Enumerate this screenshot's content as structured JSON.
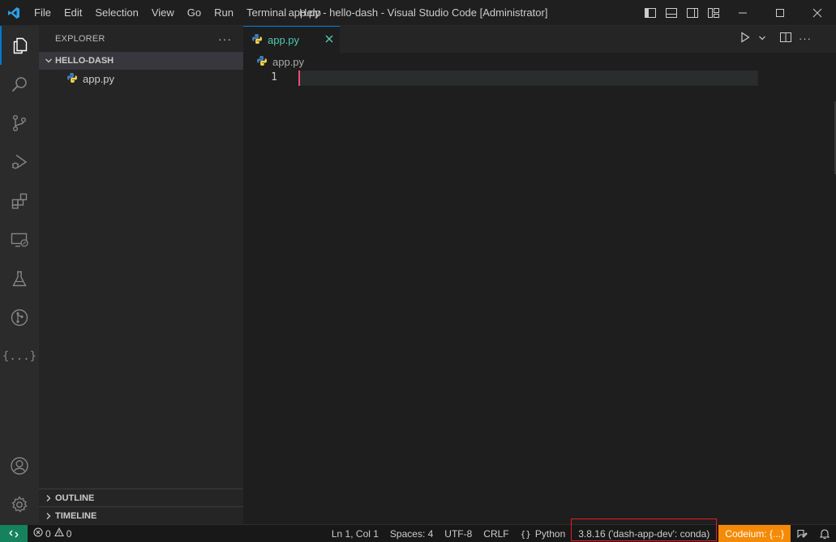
{
  "window": {
    "title": "app.py - hello-dash - Visual Studio Code [Administrator]",
    "menu": [
      "File",
      "Edit",
      "Selection",
      "View",
      "Go",
      "Run",
      "Terminal",
      "Help"
    ]
  },
  "activity_bar": {
    "items": [
      "explorer",
      "search",
      "source-control",
      "run-debug",
      "extensions",
      "remote-explorer",
      "testing",
      "git-graph",
      "json-tools"
    ],
    "bottom": [
      "accounts",
      "manage"
    ],
    "json_glyph": "{...}"
  },
  "sidebar": {
    "title": "EXPLORER",
    "more": "···",
    "folder": "HELLO-DASH",
    "files": [
      {
        "name": "app.py",
        "icon": "python-icon"
      }
    ],
    "outline": "OUTLINE",
    "timeline": "TIMELINE"
  },
  "editor": {
    "tab_label": "app.py",
    "breadcrumb": "app.py",
    "line_numbers": [
      "1"
    ]
  },
  "statusbar": {
    "errors": "0",
    "warnings": "0",
    "position": "Ln 1, Col 1",
    "spaces": "Spaces: 4",
    "encoding": "UTF-8",
    "eol": "CRLF",
    "language": "Python",
    "interpreter": "3.8.16 ('dash-app-dev': conda)",
    "codeium": "Codeium: {...}"
  },
  "colors": {
    "accent": "#0078d4",
    "tab_text": "#4ec9b0",
    "remote": "#16825d",
    "codeium": "#f58a07",
    "highlight_box": "#e51c23"
  }
}
